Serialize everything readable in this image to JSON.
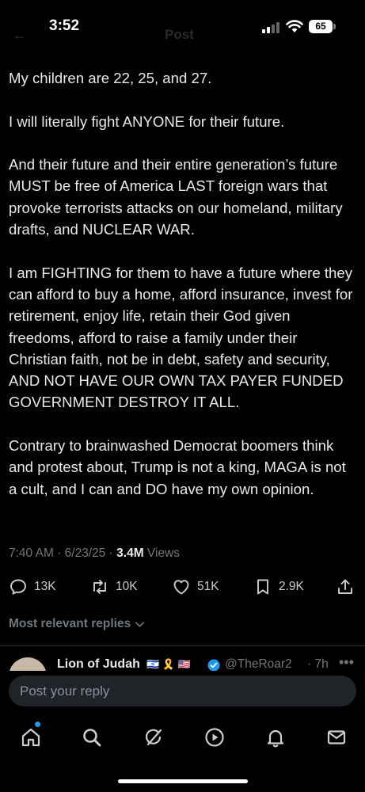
{
  "status_bar": {
    "time": "3:52",
    "battery": "65"
  },
  "header": {
    "back_label": "←",
    "title": "Post"
  },
  "post": {
    "paragraphs": [
      "My children are 22, 25, and 27.",
      "I will literally fight ANYONE for their future.",
      "And their future and their entire generation’s future MUST be free of America LAST foreign wars that provoke terrorists attacks on our homeland, military drafts, and NUCLEAR WAR.",
      "I am FIGHTING for them to have a future where they can afford to buy a home, afford insurance, invest for retirement, enjoy life, retain their God given freedoms, afford to raise a family under their Christian faith, not be in debt, safety and security, AND NOT HAVE OUR OWN TAX PAYER FUNDED GOVERNMENT DESTROY IT ALL.",
      "Contrary to brainwashed Democrat boomers think and protest about, Trump is not a king, MAGA is not a cult, and I can and DO have my own opinion."
    ],
    "meta_prefix": "7:40 AM · 6/23/25 · ",
    "views_count": "3.4M",
    "views_label": " Views"
  },
  "actions": {
    "replies": "13K",
    "reposts": "10K",
    "likes": "51K",
    "bookmarks": "2.9K"
  },
  "replies_section": {
    "header": "Most relevant replies"
  },
  "reply_preview": {
    "name": "Lion of Judah",
    "flags": "🇮🇱 🎗️ 🇺🇸",
    "handle": "@TheRoar2",
    "time": "· 7h",
    "more": "•••"
  },
  "reply_bar": {
    "placeholder": "Post your reply"
  },
  "icons": {
    "tabs": [
      "home-icon",
      "search-icon",
      "grok-icon",
      "video-icon",
      "bell-icon",
      "mail-icon"
    ]
  },
  "colors": {
    "accent": "#1d9bf0",
    "background": "#000000",
    "text": "#e7e9ea",
    "muted": "#71767b"
  }
}
